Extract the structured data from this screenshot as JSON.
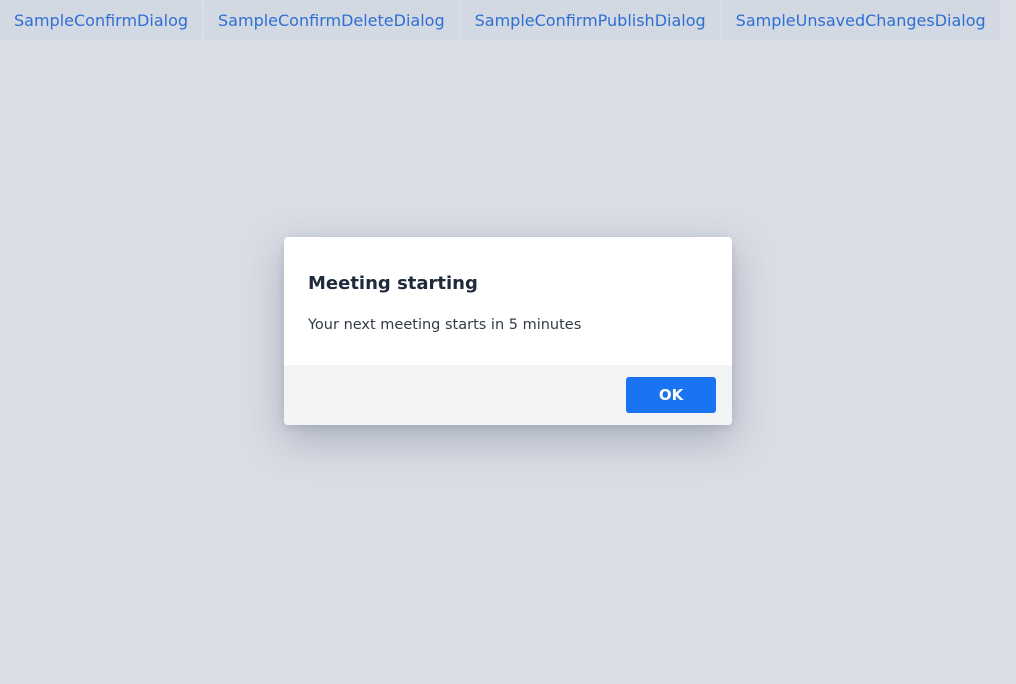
{
  "tabs": [
    {
      "label": "SampleConfirmDialog"
    },
    {
      "label": "SampleConfirmDeleteDialog"
    },
    {
      "label": "SampleConfirmPublishDialog"
    },
    {
      "label": "SampleUnsavedChangesDialog"
    }
  ],
  "dialog": {
    "title": "Meeting starting",
    "message": "Your next meeting starts in 5 minutes",
    "ok_label": "OK"
  },
  "colors": {
    "background": "#dadde5",
    "tab_background": "#d3d9e2",
    "tab_text": "#2f6fd3",
    "primary_button": "#1a73f0",
    "footer_background": "#f3f4f6"
  }
}
